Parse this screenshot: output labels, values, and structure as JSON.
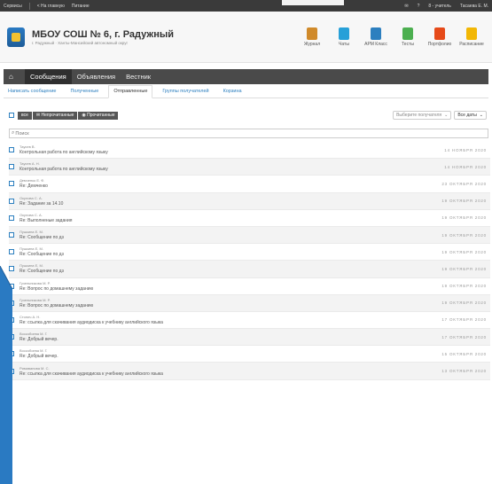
{
  "topbar": {
    "services": "Сервисы",
    "home": "< На главную",
    "food": "Питание",
    "role": "8 - учитель",
    "user": "Тасаева Е. М."
  },
  "school": {
    "name": "МБОУ СОШ № 6, г. Радужный",
    "sub": "г. Радужный · Ханты-Мансийский автономный округ"
  },
  "apps": [
    {
      "label": "Журнал",
      "color": "#d08a2a"
    },
    {
      "label": "Чаты",
      "color": "#27a0d8"
    },
    {
      "label": "АРМ Класс",
      "color": "#2c7fbf"
    },
    {
      "label": "Тесты",
      "color": "#4caf50"
    },
    {
      "label": "Портфолио",
      "color": "#e64a19"
    },
    {
      "label": "Расписание",
      "color": "#f2b705"
    }
  ],
  "nav": {
    "messages": "Сообщения",
    "ads": "Объявления",
    "herald": "Вестник"
  },
  "tabs": [
    "Написать сообщение",
    "Полученные",
    "Отправленные",
    "Группы получателей",
    "Корзина"
  ],
  "filters": {
    "all": "все",
    "unread": "Непрочитанные",
    "read": "Прочитанные"
  },
  "selects": {
    "recipients": "Выберите получателя",
    "dates": "Все даты"
  },
  "search": {
    "placeholder": "Поиск"
  },
  "messages": [
    {
      "from": "Таусев В.",
      "subject": "Контрольная работа по английскому языку",
      "date": "14 НОЯБРЯ 2020"
    },
    {
      "from": "Таусев А. Н.",
      "subject": "Контрольная работа по английскому языку",
      "date": "14 НОЯБРЯ 2020"
    },
    {
      "from": "Демченко Е. Ф.",
      "subject": "Re: Демченко",
      "date": "23 ОКТЯБРЯ 2020"
    },
    {
      "from": "Окулова С. А.",
      "subject": "Re: Задание за 14.10",
      "date": "19 ОКТЯБРЯ 2020"
    },
    {
      "from": "Окулова С. А.",
      "subject": "Re: Выполненые задания",
      "date": "19 ОКТЯБРЯ 2020"
    },
    {
      "from": "Пушкина Е. М.",
      "subject": "Re: Сообщение по дз",
      "date": "19 ОКТЯБРЯ 2020"
    },
    {
      "from": "Пушкина Е. М.",
      "subject": "Re: Сообщение по дз",
      "date": "19 ОКТЯБРЯ 2020"
    },
    {
      "from": "Пушкина Е. М.",
      "subject": "Re: Сообщение по дз",
      "date": "19 ОКТЯБРЯ 2020"
    },
    {
      "from": "Гузельникова М. Р.",
      "subject": "Re: Вопрос по домашнему заданию",
      "date": "19 ОКТЯБРЯ 2020"
    },
    {
      "from": "Гузельникова М. Р.",
      "subject": "Re: Вопрос по домашнему заданию",
      "date": "19 ОКТЯБРЯ 2020"
    },
    {
      "from": "Стонич А. Н.",
      "subject": "Re: ссылка для скачивания аудиодиска к учебнику английского языка",
      "date": "17 ОКТЯБРЯ 2020"
    },
    {
      "from": "Воскобоева М. Г.",
      "subject": "Re: Добрый вечер.",
      "date": "17 ОКТЯБРЯ 2020"
    },
    {
      "from": "Воскобоева М. Г.",
      "subject": "Re: Добрый вечер.",
      "date": "15 ОКТЯБРЯ 2020"
    },
    {
      "from": "Римиванова М. С.",
      "subject": "Re: ссылка для скачивания аудиодиска к учебнику английского языка",
      "date": "13 ОКТЯБРЯ 2020"
    }
  ],
  "colors": {
    "accent": "#2c7fbf",
    "nav": "#4a4a4a",
    "topbar": "#3a3a3a",
    "side": "#2a7ac2"
  }
}
